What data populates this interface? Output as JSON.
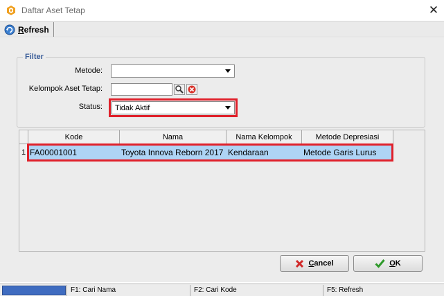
{
  "window": {
    "title": "Daftar Aset Tetap",
    "close_glyph": "✕"
  },
  "toolbar": {
    "refresh_prefix": "R",
    "refresh_rest": "efresh"
  },
  "filter": {
    "legend": "Filter",
    "metode_label": "Metode:",
    "metode_value": "",
    "kelompok_label": "Kelompok Aset Tetap:",
    "kelompok_value": "",
    "status_label": "Status:",
    "status_value": "Tidak Aktif"
  },
  "grid": {
    "columns": [
      "Kode",
      "Nama",
      "Nama Kelompok",
      "Metode Depresiasi"
    ],
    "rows": [
      {
        "num": "1",
        "kode": "FA00001001",
        "nama": "Toyota Innova Reborn 2017",
        "kelompok": "Kendaraan",
        "metode": "Metode Garis Lurus"
      }
    ]
  },
  "buttons": {
    "cancel_prefix": "C",
    "cancel_rest": "ancel",
    "ok_prefix": "O",
    "ok_rest": "K"
  },
  "statusbar": {
    "items": [
      "F1: Cari Nama",
      "F2: Cari Kode",
      "F5: Refresh"
    ]
  },
  "colors": {
    "highlight": "#e0202a",
    "selected_row": "#aed4f5",
    "status_active": "#3f6cc0"
  }
}
